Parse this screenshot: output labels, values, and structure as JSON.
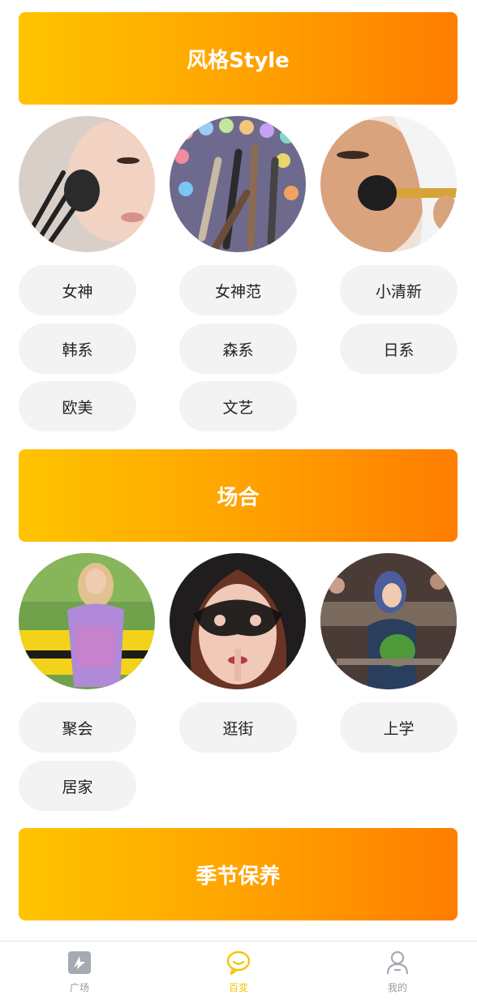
{
  "sections": [
    {
      "title": "风格Style",
      "images": [
        "makeup-brush-cheek-photo",
        "brush-set-palette-photo",
        "blush-brush-face-photo"
      ],
      "chips": [
        "女神",
        "女神范",
        "小清新",
        "韩系",
        "森系",
        "日系",
        "欧美",
        "文艺"
      ]
    },
    {
      "title": "场合",
      "images": [
        "woman-by-yellow-car-photo",
        "lace-mask-woman-photo",
        "woman-in-cafe-photo"
      ],
      "chips": [
        "聚会",
        "逛街",
        "上学",
        "居家"
      ]
    },
    {
      "title": "季节保养"
    }
  ],
  "tabbar": {
    "tabs": [
      {
        "label": "广场",
        "icon": "plaza-icon",
        "active": false
      },
      {
        "label": "百变",
        "icon": "chat-bubble-icon",
        "active": true
      },
      {
        "label": "我的",
        "icon": "person-icon",
        "active": false
      }
    ],
    "colors": {
      "active": "#f5c400",
      "inactive": "#9a9a9a"
    }
  },
  "colors": {
    "banner_gradient": [
      "#ffc400",
      "#ff7d00"
    ],
    "chip_bg": "#f3f3f3"
  }
}
